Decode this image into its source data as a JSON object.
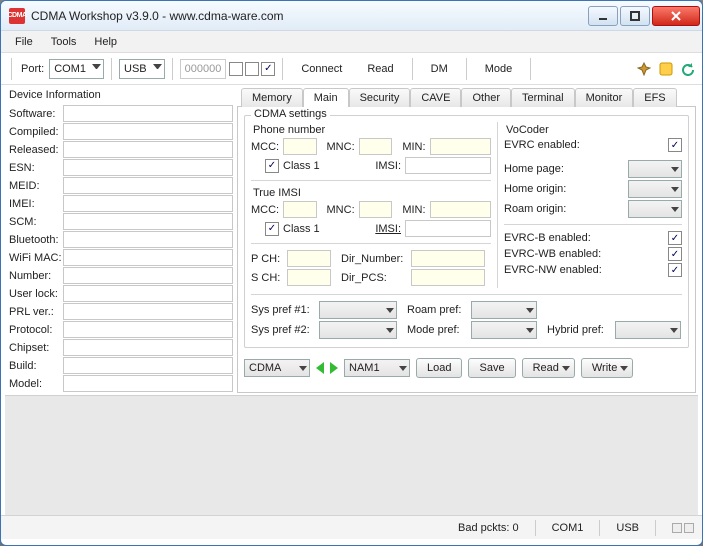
{
  "window": {
    "title": "CDMA Workshop v3.9.0   -   www.cdma-ware.com",
    "app_icon_text": "CDMA"
  },
  "menu": {
    "file": "File",
    "tools": "Tools",
    "help": "Help"
  },
  "toolbar": {
    "port_label": "Port:",
    "port_value": "COM1",
    "usb_value": "USB",
    "counter": "000000",
    "connect": "Connect",
    "read": "Read",
    "dm": "DM",
    "mode": "Mode"
  },
  "device_info": {
    "title": "Device Information",
    "rows": [
      {
        "label": "Software:"
      },
      {
        "label": "Compiled:"
      },
      {
        "label": "Released:"
      },
      {
        "label": "ESN:"
      },
      {
        "label": "MEID:"
      },
      {
        "label": "IMEI:"
      },
      {
        "label": "SCM:"
      },
      {
        "label": "Bluetooth:"
      },
      {
        "label": "WiFi MAC:"
      },
      {
        "label": "Number:"
      },
      {
        "label": "User lock:"
      },
      {
        "label": "PRL ver.:"
      },
      {
        "label": "Protocol:"
      },
      {
        "label": "Chipset:"
      },
      {
        "label": "Build:"
      },
      {
        "label": "Model:"
      }
    ]
  },
  "tabs": {
    "items": [
      "Memory",
      "Main",
      "Security",
      "CAVE",
      "Other",
      "Terminal",
      "Monitor",
      "EFS"
    ],
    "active": "Main"
  },
  "main": {
    "cdma_settings": "CDMA settings",
    "phone_number": "Phone number",
    "mcc": "MCC:",
    "mnc": "MNC:",
    "min": "MIN:",
    "class1": "Class 1",
    "imsi": "IMSI:",
    "true_imsi": "True IMSI",
    "pch": "P CH:",
    "sch": "S CH:",
    "dir_number": "Dir_Number:",
    "dir_pcs": "Dir_PCS:",
    "sys_pref1": "Sys pref #1:",
    "sys_pref2": "Sys pref #2:",
    "roam_pref": "Roam pref:",
    "mode_pref": "Mode pref:",
    "hybrid_pref": "Hybrid pref:",
    "vocoder": "VoCoder",
    "evrc_enabled": "EVRC enabled:",
    "home_page": "Home page:",
    "home_origin": "Home origin:",
    "roam_origin": "Roam origin:",
    "evrc_b": "EVRC-B enabled:",
    "evrc_wb": "EVRC-WB enabled:",
    "evrc_nw": "EVRC-NW enabled:",
    "cdma": "CDMA",
    "nam1": "NAM1",
    "load": "Load",
    "save": "Save",
    "read": "Read",
    "write": "Write"
  },
  "status": {
    "bad_pckts": "Bad pckts: 0",
    "port": "COM1",
    "usb": "USB"
  }
}
